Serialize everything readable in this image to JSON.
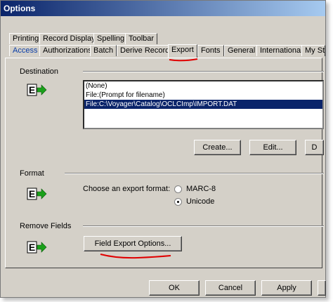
{
  "window": {
    "title": "Options"
  },
  "tabs": {
    "row1": [
      "Printing",
      "Record Display",
      "Spelling",
      "Toolbar"
    ],
    "row2": [
      "Access",
      "Authorizations",
      "Batch",
      "Derive Record",
      "Export",
      "Fonts",
      "General",
      "International",
      "My Sta"
    ],
    "active": "Export"
  },
  "destination": {
    "label": "Destination",
    "list": [
      "(None)",
      "File:(Prompt for filename)",
      "File:C:\\Voyager\\Catalog\\OCLCImp\\IMPORT.DAT"
    ],
    "selected_index": 2,
    "buttons": {
      "create": "Create...",
      "edit": "Edit...",
      "delete": "D"
    }
  },
  "format": {
    "label": "Format",
    "prompt": "Choose an export format:",
    "options": [
      "MARC-8",
      "Unicode"
    ],
    "selected": "Unicode"
  },
  "remove_fields": {
    "label": "Remove Fields",
    "button": "Field Export Options..."
  },
  "footer": {
    "ok": "OK",
    "cancel": "Cancel",
    "apply": "Apply"
  },
  "icons": {
    "export": "export-icon"
  },
  "colors": {
    "annotation": "#e00000",
    "selection": "#0a246a",
    "tab_text_blue": "#0a3ea8"
  }
}
